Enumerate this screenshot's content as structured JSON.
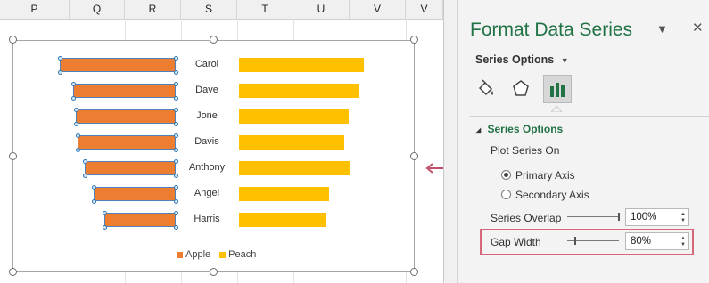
{
  "columns": [
    "P",
    "Q",
    "R",
    "S",
    "T",
    "U",
    "V",
    "V"
  ],
  "chart_data": {
    "type": "bar",
    "orientation": "horizontal-butterfly",
    "categories": [
      "Carol",
      "Dave",
      "Jone",
      "Davis",
      "Anthony",
      "Angel",
      "Harris"
    ],
    "series": [
      {
        "name": "Apple",
        "values": [
          130,
          115,
          112,
          110,
          102,
          92,
          80
        ],
        "color": "#ed7d31",
        "direction": "left"
      },
      {
        "name": "Peach",
        "values": [
          140,
          135,
          123,
          118,
          125,
          101,
          98
        ],
        "color": "#ffc000",
        "direction": "right"
      }
    ],
    "legend": "bottom",
    "grid": false
  },
  "pane": {
    "title": "Format Data Series",
    "dropdown_icon": "chevron-down-icon",
    "close_icon": "close-icon",
    "series_options_label": "Series Options",
    "icons": [
      "paint-bucket-icon",
      "pentagon-icon",
      "bar-chart-icon"
    ],
    "section_title": "Series Options",
    "plot_series_on": "Plot Series On",
    "primary_axis": "Primary Axis",
    "secondary_axis": "Secondary Axis",
    "series_overlap_label": "Series Overlap",
    "series_overlap_value": "100%",
    "series_overlap_level": 1.0,
    "gap_width_label": "Gap Width",
    "gap_width_value": "80%",
    "gap_width_level": 0.16
  },
  "colors": {
    "accent": "#217346",
    "highlight": "#d6677a",
    "apple": "#ed7d31",
    "peach": "#ffc000"
  }
}
